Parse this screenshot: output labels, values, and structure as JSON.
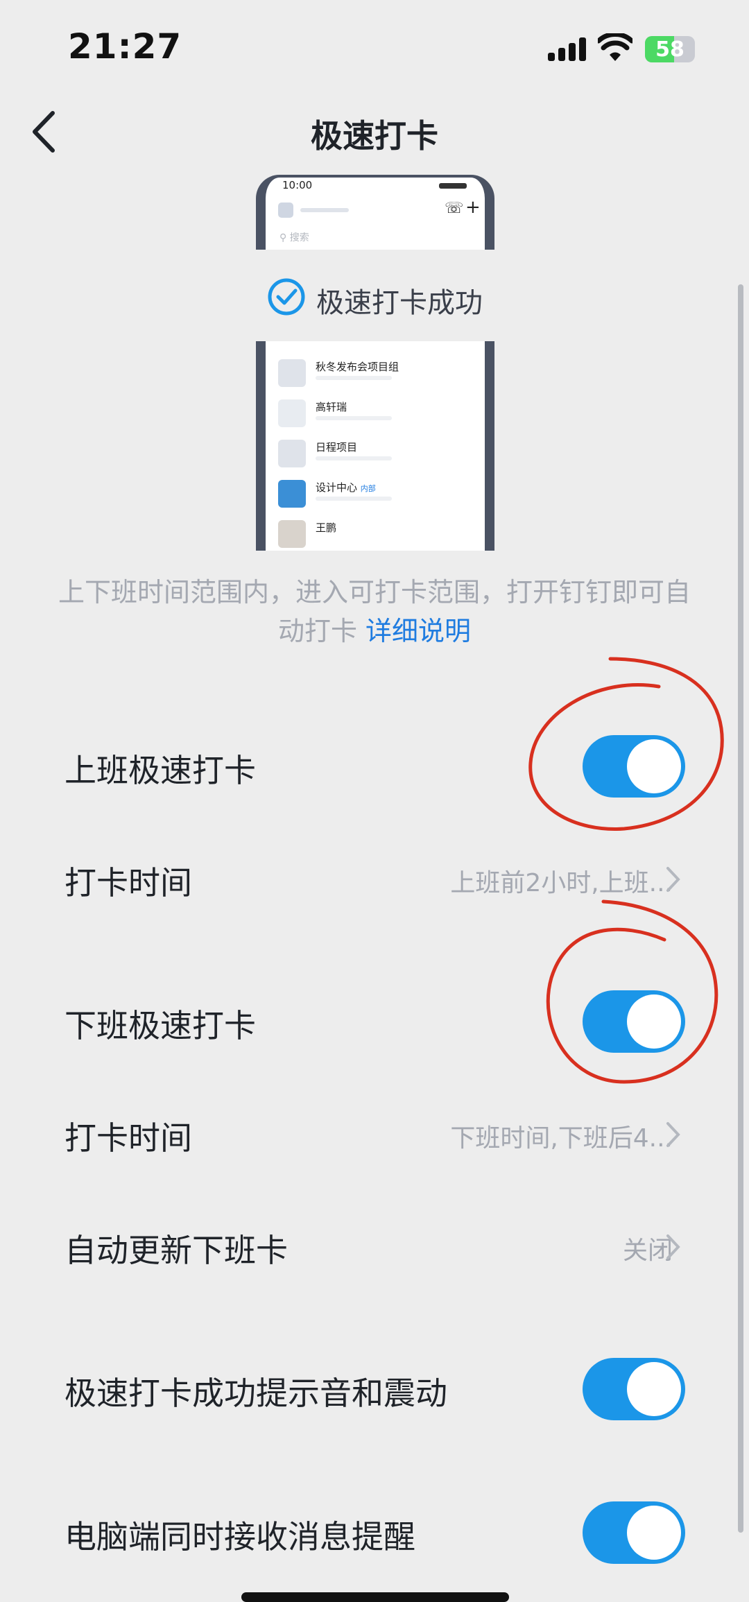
{
  "status_bar": {
    "time": "21:27",
    "battery": "58",
    "icons": [
      "signal-icon",
      "wifi-icon",
      "battery-icon"
    ]
  },
  "nav": {
    "title": "极速打卡",
    "back_icon": "chevron-left-icon"
  },
  "preview": {
    "phone_time": "10:00",
    "search_placeholder": "搜索",
    "success_text": "极速打卡成功",
    "chats": [
      "秋冬发布会项目组",
      "高轩瑞",
      "日程项目",
      "设计中心",
      "王鹏"
    ],
    "chat_tag": "内部"
  },
  "description": {
    "text": "上下班时间范围内，进入可打卡范围，打开钉钉即可自动打卡",
    "link": "详细说明"
  },
  "settings": [
    {
      "label": "上班极速打卡",
      "toggle": true
    },
    {
      "label": "打卡时间",
      "value": "上班前2小时,上班..."
    },
    {
      "label": "下班极速打卡",
      "toggle": true
    },
    {
      "label": "打卡时间",
      "value": "下班时间,下班后4..."
    },
    {
      "label": "自动更新下班卡",
      "value": "关闭"
    },
    {
      "label": "极速打卡成功提示音和震动",
      "toggle": true
    },
    {
      "label": "电脑端同时接收消息提醒",
      "toggle": true
    }
  ],
  "colors": {
    "accent": "#1b96e8",
    "link": "#1f7ce0",
    "annotation": "#d8301f"
  }
}
